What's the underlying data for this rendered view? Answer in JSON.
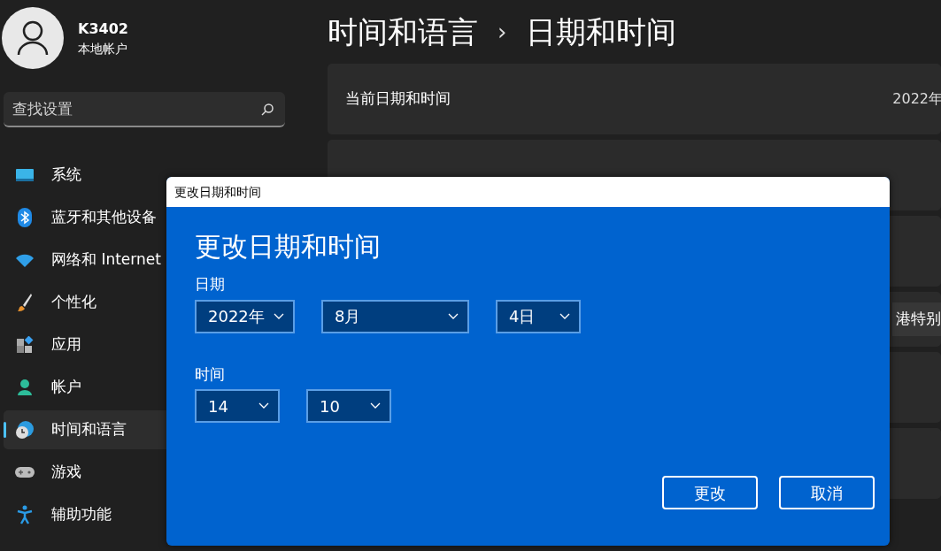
{
  "user": {
    "name": "K3402",
    "account_type": "本地帐户"
  },
  "search": {
    "placeholder": "查找设置"
  },
  "nav": [
    {
      "label": "系统",
      "selected": false
    },
    {
      "label": "蓝牙和其他设备",
      "selected": false
    },
    {
      "label": "网络和 Internet",
      "selected": false
    },
    {
      "label": "个性化",
      "selected": false
    },
    {
      "label": "应用",
      "selected": false
    },
    {
      "label": "帐户",
      "selected": false
    },
    {
      "label": "时间和语言",
      "selected": true
    },
    {
      "label": "游戏",
      "selected": false
    },
    {
      "label": "辅助功能",
      "selected": false
    }
  ],
  "breadcrumb": {
    "parent": "时间和语言",
    "separator": "›",
    "current": "日期和时间"
  },
  "settings": [
    {
      "label": "当前日期和时间",
      "value": "2022年"
    },
    {
      "value": "港特别"
    }
  ],
  "dialog": {
    "window_title": "更改日期和时间",
    "heading": "更改日期和时间",
    "date_label": "日期",
    "date": [
      {
        "value": "2022年"
      },
      {
        "value": "8月"
      },
      {
        "value": "4日"
      }
    ],
    "time_label": "时间",
    "time": [
      {
        "value": "14"
      },
      {
        "value": "10"
      }
    ],
    "buttons": [
      {
        "label": "更改"
      },
      {
        "label": "取消"
      }
    ]
  }
}
